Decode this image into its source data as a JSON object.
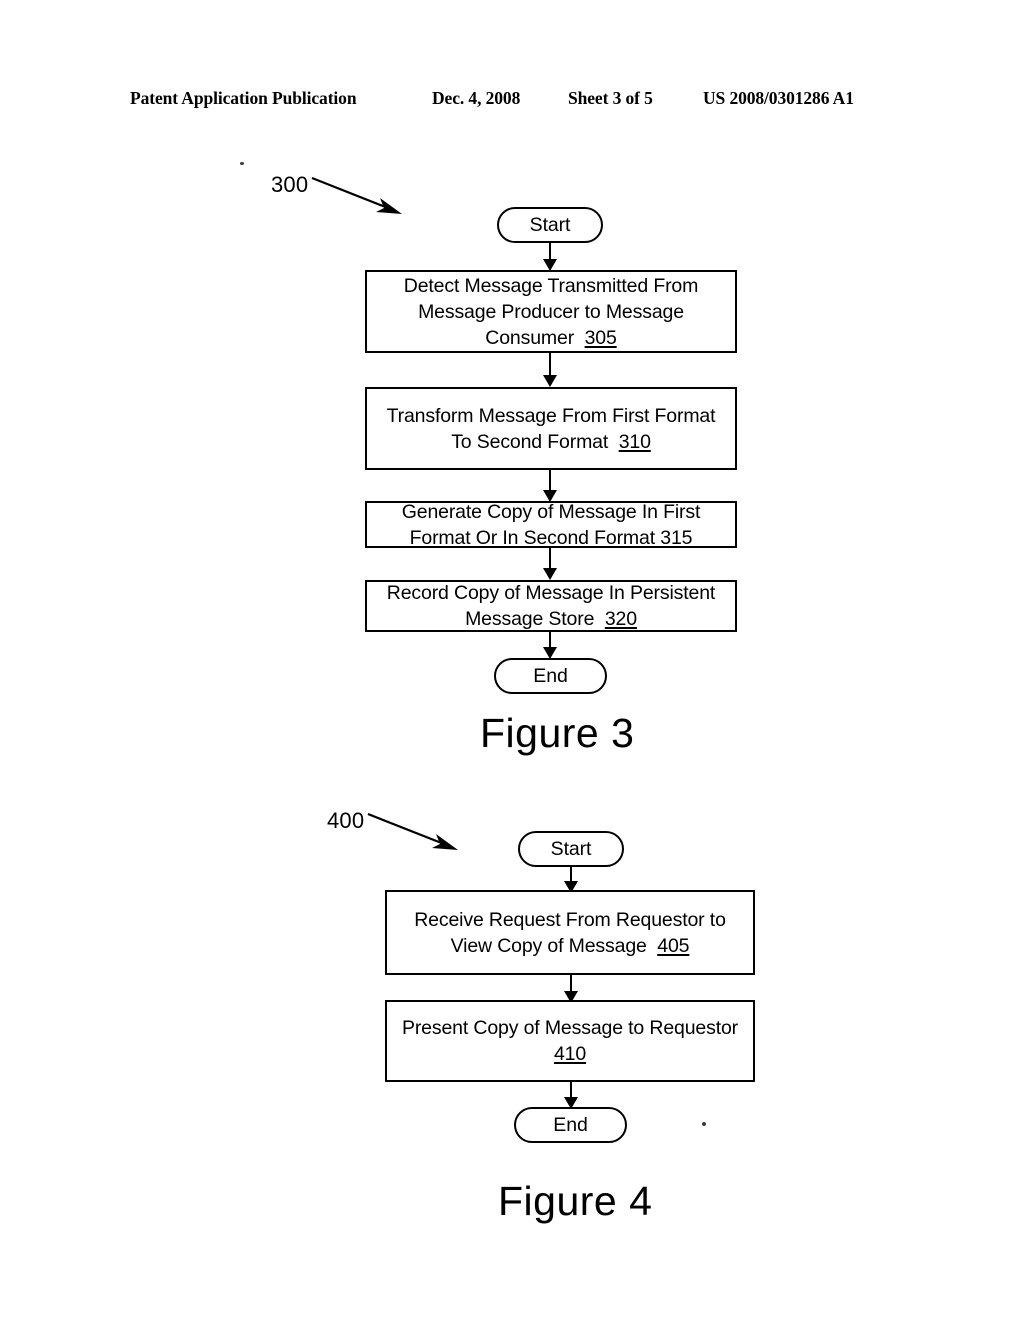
{
  "header": {
    "publication": "Patent Application Publication",
    "date": "Dec. 4, 2008",
    "sheet": "Sheet 3 of 5",
    "patent_number": "US 2008/0301286 A1"
  },
  "figure3": {
    "caption": "Figure 3",
    "lead_label": "300",
    "nodes": {
      "start": "Start",
      "step305_line1": "Detect Message Transmitted From",
      "step305_line2": "Message Producer to Message",
      "step305_line3": "Consumer",
      "step305_ref": "305",
      "step310_line1": "Transform Message From First Format",
      "step310_line2": "To Second Format",
      "step310_ref": "310",
      "step315_line1": "Generate Copy of Message In First",
      "step315_line2": "Format Or In Second Format",
      "step315_ref": "315",
      "step320_line1": "Record Copy of Message In Persistent",
      "step320_line2": "Message Store",
      "step320_ref": "320",
      "end": "End"
    }
  },
  "figure4": {
    "caption": "Figure 4",
    "lead_label": "400",
    "nodes": {
      "start": "Start",
      "step405_line1": "Receive Request From Requestor to",
      "step405_line2": "View Copy of Message",
      "step405_ref": "405",
      "step410_line1": "Present Copy of Message to Requestor",
      "step410_ref": "410",
      "end": "End"
    }
  },
  "colors": {
    "ink": "#000000",
    "paper": "#ffffff"
  }
}
